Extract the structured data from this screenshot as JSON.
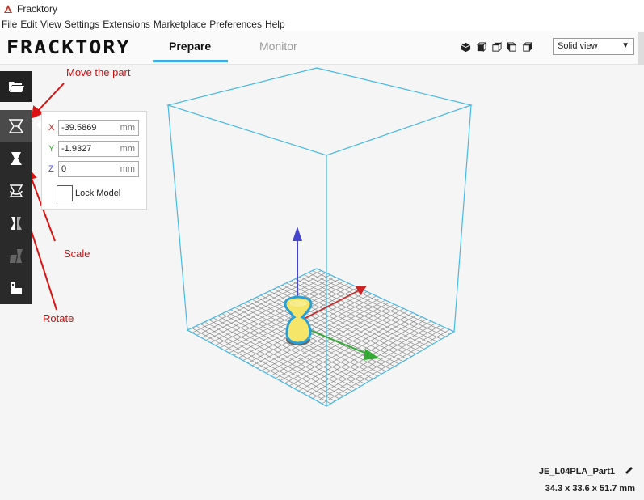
{
  "window": {
    "title": "Fracktory"
  },
  "menu": [
    "File",
    "Edit",
    "View",
    "Settings",
    "Extensions",
    "Marketplace",
    "Preferences",
    "Help"
  ],
  "header": {
    "logo": "FRACKTORY",
    "tabs": [
      {
        "label": "Prepare",
        "active": true
      },
      {
        "label": "Monitor",
        "active": false
      }
    ],
    "view_mode": "Solid view"
  },
  "toolbar": {
    "tools": [
      "open-file",
      "move",
      "scale",
      "rotate",
      "mirror",
      "per-model-settings",
      "support-blocker"
    ],
    "active": "move"
  },
  "move_panel": {
    "x": {
      "label": "X",
      "value": "-39.5869",
      "unit": "mm"
    },
    "y": {
      "label": "Y",
      "value": "-1.9327",
      "unit": "mm"
    },
    "z": {
      "label": "Z",
      "value": "0",
      "unit": "mm"
    },
    "lock_label": "Lock Model"
  },
  "annotations": {
    "move": "Move the part",
    "scale": "Scale",
    "rotate": "Rotate"
  },
  "model": {
    "name": "JE_L04PLA_Part1",
    "dimensions": "34.3 x 33.6 x 51.7 mm"
  },
  "colors": {
    "accent": "#3ab0e0",
    "annotation": "#cc1111",
    "axis_x": "#cc2222",
    "axis_y": "#33aa33",
    "axis_z": "#4444cc",
    "model": "#f5e66a"
  }
}
